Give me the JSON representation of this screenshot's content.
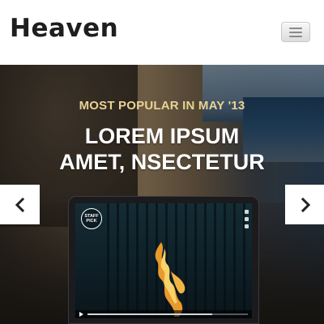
{
  "header": {
    "logo": "Heaven",
    "menu_icon": "hamburger-icon"
  },
  "hero": {
    "tagline": "MOST POPULAR IN MAY '13",
    "headline_line1": "LOREM IPSUM",
    "headline_line2": "AMET, NSECTETUR",
    "prev_icon": "chevron-left-icon",
    "next_icon": "chevron-right-icon"
  },
  "laptop": {
    "badge_line1": "STAFF",
    "badge_line2": "PICK",
    "video_progress": 0.78
  },
  "colors": {
    "tagline": "#e8d394",
    "headline": "#ffffff",
    "logo": "#1e1e1e"
  }
}
